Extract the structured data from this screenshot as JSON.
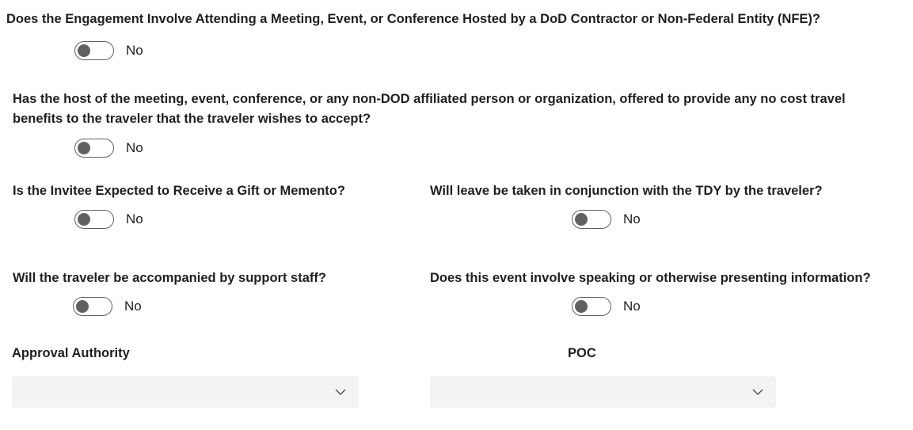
{
  "questions": {
    "q1": {
      "text": "Does the Engagement Involve Attending a Meeting, Event, or Conference Hosted by a DoD Contractor or Non-Federal Entity (NFE)?",
      "value": "No"
    },
    "q2": {
      "text": "Has the host of the meeting, event, conference, or any non-DOD affiliated person or organization, offered to provide any no cost travel benefits to the traveler that the traveler wishes to accept?",
      "value": "No"
    },
    "q3": {
      "text": "Is the Invitee Expected to Receive a Gift or Memento?",
      "value": "No"
    },
    "q4": {
      "text": "Will leave be taken in conjunction with the TDY by the traveler?",
      "value": "No"
    },
    "q5": {
      "text": "Will the traveler be accompanied by support staff?",
      "value": "No"
    },
    "q6": {
      "text": "Does this event involve speaking or otherwise presenting information?",
      "value": "No"
    }
  },
  "fields": {
    "approval_authority": {
      "label": "Approval Authority",
      "value": ""
    },
    "poc": {
      "label": "POC",
      "value": ""
    }
  },
  "icons": {
    "dropdown": "chevron-down-icon"
  },
  "colors": {
    "toggle_off_knob": "#616161",
    "toggle_border": "#606060",
    "dropdown_bg": "#f3f3f3",
    "text": "#1f1f1f"
  }
}
